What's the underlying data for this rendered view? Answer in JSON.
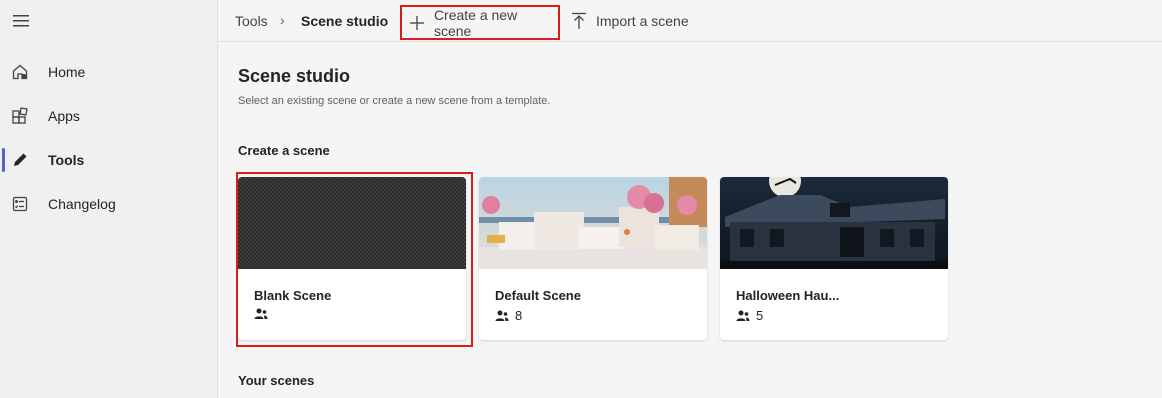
{
  "sidebar": {
    "items": [
      {
        "label": "Home",
        "icon": "home-icon"
      },
      {
        "label": "Apps",
        "icon": "apps-icon"
      },
      {
        "label": "Tools",
        "icon": "pen-icon",
        "active": true
      },
      {
        "label": "Changelog",
        "icon": "changelog-icon"
      }
    ]
  },
  "breadcrumb": {
    "parent": "Tools",
    "separator": "›",
    "current": "Scene studio"
  },
  "toolbar": {
    "create_label": "Create a new scene",
    "import_label": "Import a scene"
  },
  "page": {
    "title": "Scene studio",
    "subtitle": "Select an existing scene or create a new scene from a template."
  },
  "create_section": {
    "title": "Create a scene",
    "cards": [
      {
        "title": "Blank Scene",
        "participants": ""
      },
      {
        "title": "Default Scene",
        "participants": "8"
      },
      {
        "title": "Halloween Hau...",
        "participants": "5"
      }
    ]
  },
  "your_scenes": {
    "title": "Your scenes"
  },
  "colors": {
    "accent": "#5b5fc7",
    "highlight": "#d91c1c"
  }
}
